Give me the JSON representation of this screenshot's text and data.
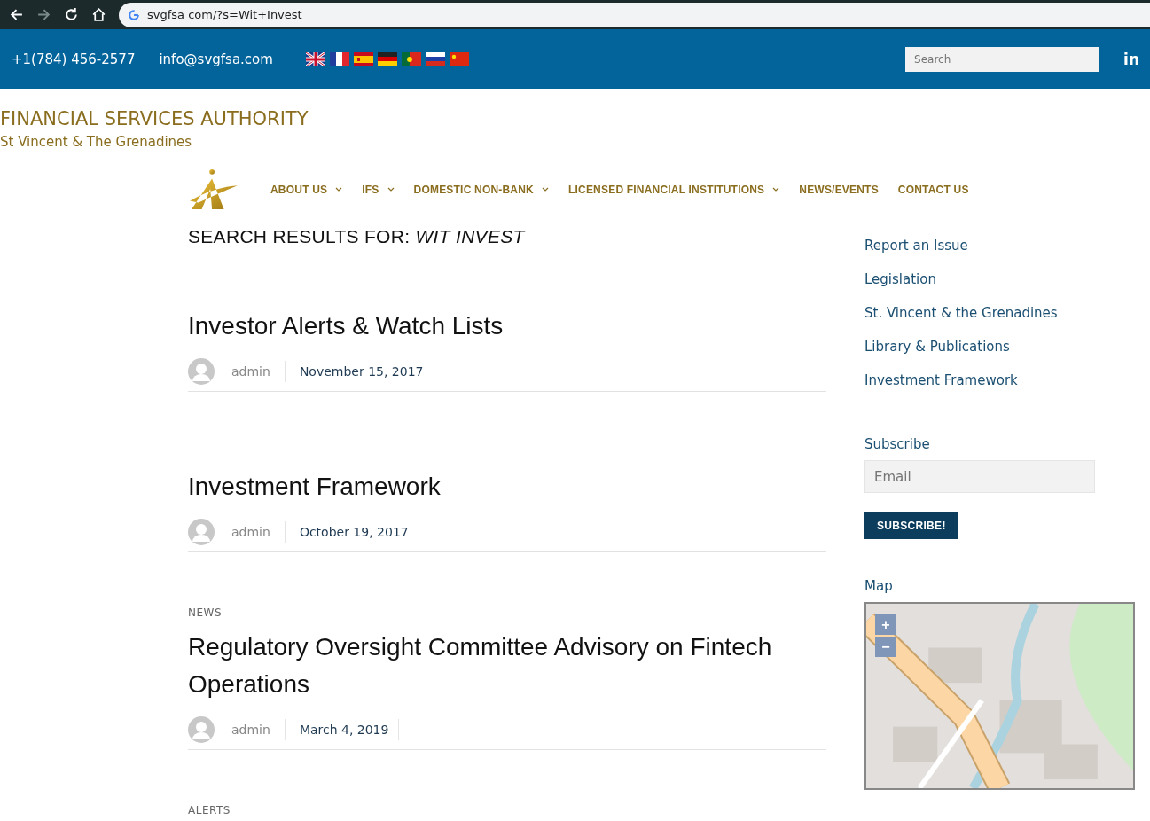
{
  "browser": {
    "url": "svgfsa com/?s=Wit+Invest",
    "forward_disabled": true
  },
  "topbar": {
    "phone": "+1(784) 456-2577",
    "email": "info@svgfsa.com",
    "flags": [
      {
        "kind": "uk"
      },
      {
        "kind": "fr"
      },
      {
        "kind": "es"
      },
      {
        "kind": "de"
      },
      {
        "kind": "pt"
      },
      {
        "kind": "ru"
      },
      {
        "kind": "cn"
      }
    ],
    "search": {
      "placeholder": "Search"
    },
    "social": "in"
  },
  "site": {
    "title": "FINANCIAL SERVICES AUTHORITY",
    "subtitle": "St Vincent & The Grenadines"
  },
  "nav": [
    {
      "label": "ABOUT US",
      "dropdown": true
    },
    {
      "label": "IFS",
      "dropdown": true
    },
    {
      "label": "DOMESTIC NON-BANK",
      "dropdown": true
    },
    {
      "label": "LICENSED FINANCIAL INSTITUTIONS",
      "dropdown": true
    },
    {
      "label": "NEWS/EVENTS",
      "dropdown": false
    },
    {
      "label": "CONTACT US",
      "dropdown": false
    }
  ],
  "search_heading": {
    "prefix": "SEARCH RESULTS FOR:",
    "query": "WIT INVEST"
  },
  "posts": [
    {
      "title": "Investor Alerts & Watch Lists",
      "author": "admin",
      "date": "November 15, 2017"
    },
    {
      "title": "Investment Framework",
      "author": "admin",
      "date": "October 19, 2017"
    },
    {
      "category": "NEWS",
      "title": "Regulatory Oversight Committee Advisory on Fintech Operations",
      "author": "admin",
      "date": "March 4, 2019"
    },
    {
      "category": "ALERTS"
    }
  ],
  "sidebar": {
    "links": [
      "Report an Issue",
      "Legislation",
      "St. Vincent & the Grenadines",
      "Library & Publications",
      "Investment Framework"
    ],
    "subscribe": {
      "heading": "Subscribe",
      "placeholder": "Email",
      "button": "SUBSCRIBE!"
    },
    "map": {
      "heading": "Map",
      "zoom_in": "+",
      "zoom_out": "−"
    }
  }
}
